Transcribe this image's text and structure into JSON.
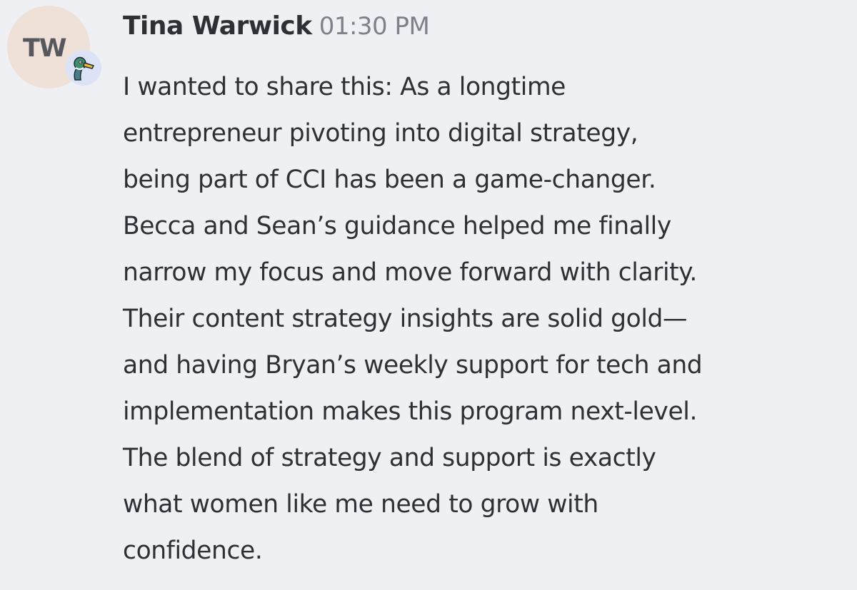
{
  "message": {
    "avatar": {
      "initials": "TW",
      "badge_icon": "duck-icon",
      "background_color": "#efe0d8",
      "badge_color": "#dde3f6"
    },
    "author": "Tina Warwick",
    "timestamp": "01:30 PM",
    "body_lines": [
      "I wanted to share this: As a longtime",
      "entrepreneur pivoting into digital strategy,",
      "being part of CCI has been a game-changer.",
      "Becca and Sean’s guidance helped me finally",
      "narrow my focus and move forward with clarity.",
      "Their content strategy insights are solid gold—",
      "and having Bryan’s weekly support for tech and",
      "implementation makes this program next-level.",
      "The blend of strategy and support is exactly",
      "what women like me need to grow with",
      "confidence."
    ]
  }
}
